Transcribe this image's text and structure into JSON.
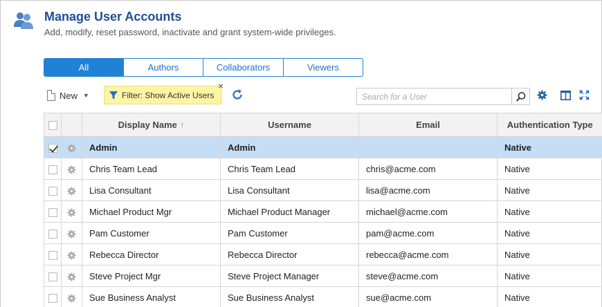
{
  "header": {
    "title": "Manage User Accounts",
    "subtitle": "Add, modify, reset password, inactivate and grant system-wide privileges.",
    "icon": "users-icon"
  },
  "tabs": [
    {
      "label": "All",
      "active": true
    },
    {
      "label": "Authors",
      "active": false
    },
    {
      "label": "Collaborators",
      "active": false
    },
    {
      "label": "Viewers",
      "active": false
    }
  ],
  "toolbar": {
    "new_label": "New",
    "filter_label": "Filter: Show Active Users",
    "filter_close": "×",
    "search_placeholder": "Search for a User"
  },
  "table": {
    "columns": [
      "Display Name",
      "Username",
      "Email",
      "Authentication Type"
    ],
    "sorted_column": "Display Name",
    "sort_direction": "ascending",
    "rows": [
      {
        "display_name": "Admin",
        "username": "Admin",
        "email": "",
        "auth": "Native",
        "selected": true
      },
      {
        "display_name": "Chris Team Lead",
        "username": "Chris Team Lead",
        "email": "chris@acme.com",
        "auth": "Native",
        "selected": false
      },
      {
        "display_name": "Lisa Consultant",
        "username": "Lisa Consultant",
        "email": "lisa@acme.com",
        "auth": "Native",
        "selected": false
      },
      {
        "display_name": "Michael Product Mgr",
        "username": "Michael Product Manager",
        "email": "michael@acme.com",
        "auth": "Native",
        "selected": false
      },
      {
        "display_name": "Pam Customer",
        "username": "Pam Customer",
        "email": "pam@acme.com",
        "auth": "Native",
        "selected": false
      },
      {
        "display_name": "Rebecca Director",
        "username": "Rebecca Director",
        "email": "rebecca@acme.com",
        "auth": "Native",
        "selected": false
      },
      {
        "display_name": "Steve Project Mgr",
        "username": "Steve Project Manager",
        "email": "steve@acme.com",
        "auth": "Native",
        "selected": false
      },
      {
        "display_name": "Sue Business Analyst",
        "username": "Sue Business Analyst",
        "email": "sue@acme.com",
        "auth": "Native",
        "selected": false
      }
    ]
  },
  "colors": {
    "title": "#1f4e96",
    "accent": "#1f82d4",
    "selected_row": "#c5def5",
    "filter_chip": "#fdf5a6"
  }
}
